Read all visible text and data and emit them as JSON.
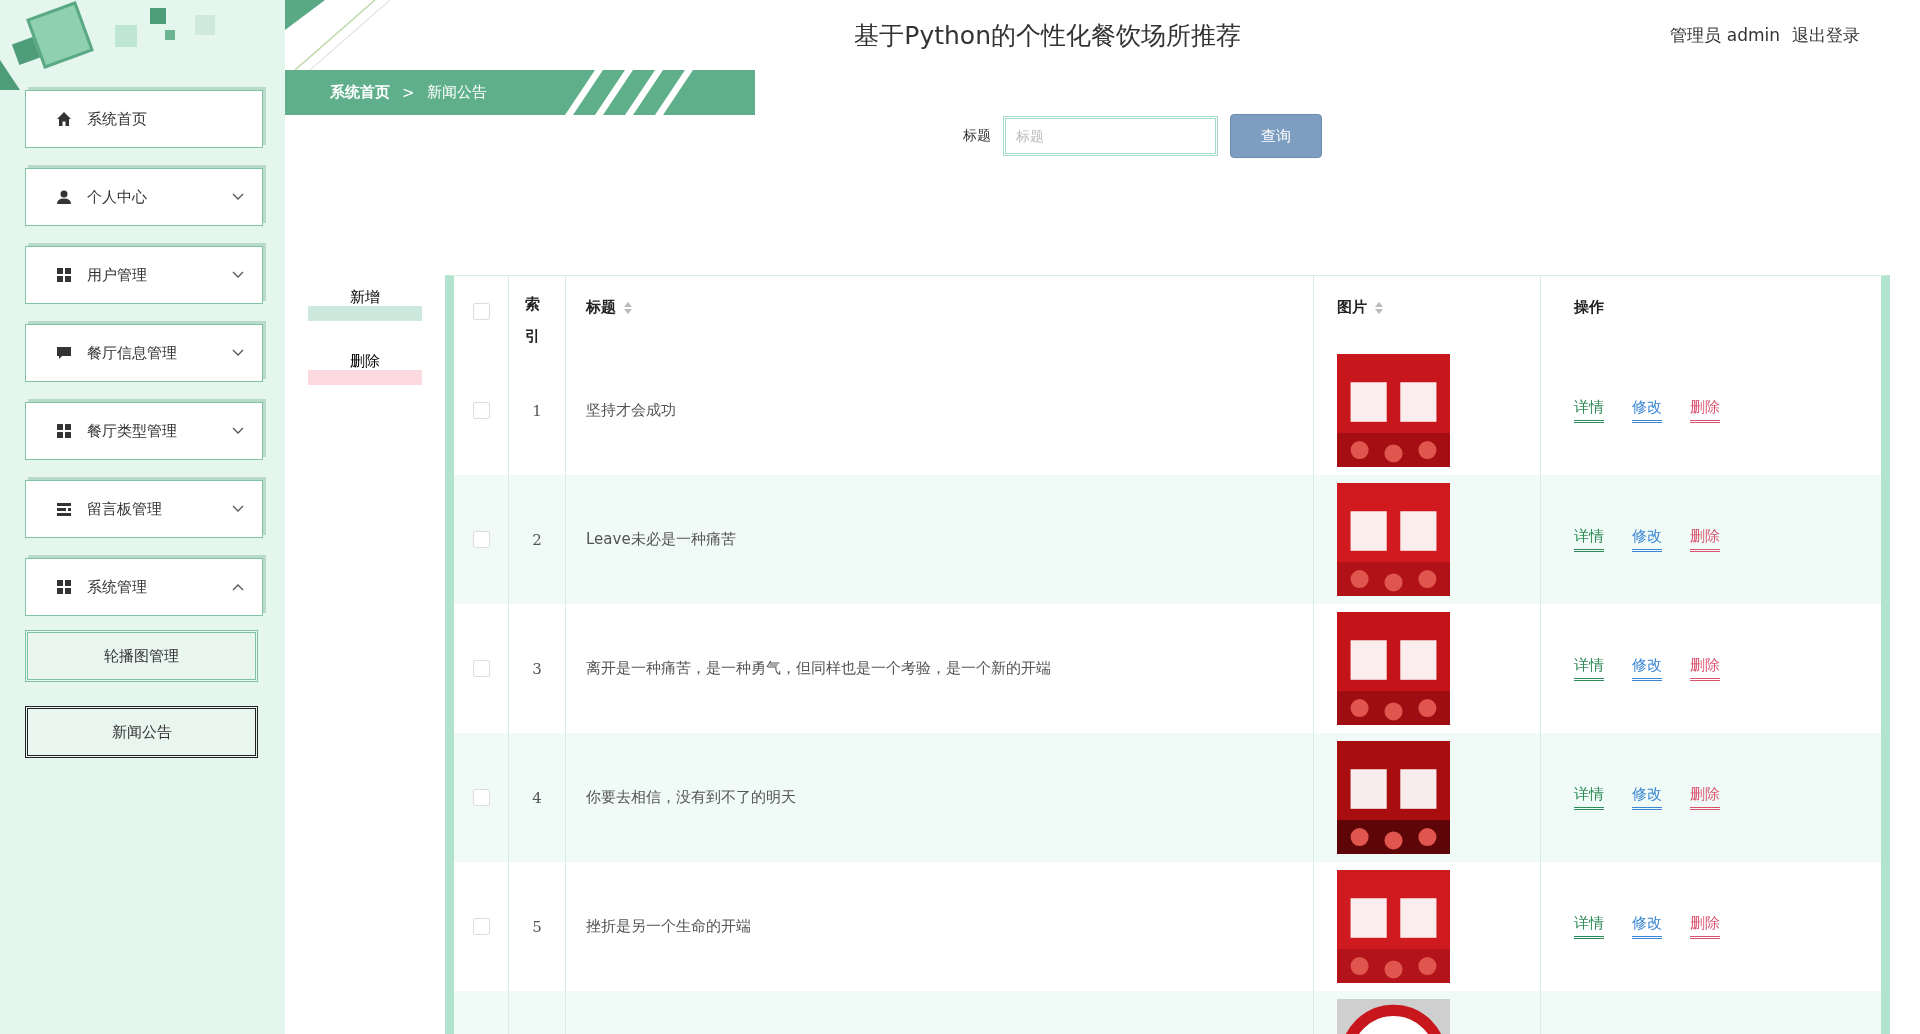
{
  "sidebar": {
    "items": [
      {
        "label": "系统首页",
        "kind": "home"
      },
      {
        "label": "个人中心",
        "kind": "person",
        "expanded": false
      },
      {
        "label": "用户管理",
        "kind": "grid",
        "expanded": false
      },
      {
        "label": "餐厅信息管理",
        "kind": "chat",
        "expanded": false
      },
      {
        "label": "餐厅类型管理",
        "kind": "grid",
        "expanded": false
      },
      {
        "label": "留言板管理",
        "kind": "list",
        "expanded": false
      },
      {
        "label": "系统管理",
        "kind": "grid",
        "expanded": true,
        "children": [
          {
            "label": "轮播图管理",
            "selected": false
          },
          {
            "label": "新闻公告",
            "selected": true
          }
        ]
      }
    ]
  },
  "header": {
    "title": "基于Python的个性化餐饮场所推荐",
    "user": "管理员 admin",
    "logout": "退出登录"
  },
  "breadcrumb": {
    "items": [
      "系统首页",
      "新闻公告"
    ],
    "separator": ">"
  },
  "search": {
    "label": "标题",
    "placeholder": "标题",
    "button": "查询"
  },
  "toolbar": [
    {
      "label": "新增",
      "kind": "add"
    },
    {
      "label": "删除",
      "kind": "delete"
    }
  ],
  "table": {
    "header_checked": false,
    "columns": [
      {
        "label": "索引"
      },
      {
        "label": "标题",
        "sortable": true
      },
      {
        "label": "图片",
        "sortable": true
      },
      {
        "label": "操作"
      }
    ],
    "rows": [
      {
        "kind": "full",
        "index": "1",
        "title": "坚持才会成功",
        "checked": false,
        "actions": [
          {
            "label": "详情",
            "color": "#2e8b57"
          },
          {
            "label": "修改",
            "color": "#3a86d4"
          },
          {
            "label": "删除",
            "color": "#d9536f"
          }
        ]
      },
      {
        "kind": "full",
        "index": "2",
        "title": "Leave未必是一种痛苦",
        "checked": false,
        "actions": [
          {
            "label": "详情",
            "color": "#2e8b57"
          },
          {
            "label": "修改",
            "color": "#3a86d4"
          },
          {
            "label": "删除",
            "color": "#d9536f"
          }
        ]
      },
      {
        "kind": "full",
        "index": "3",
        "title": "离开是一种痛苦，是一种勇气，但同样也是一个考验，是一个新的开端",
        "checked": false,
        "actions": [
          {
            "label": "详情",
            "color": "#2e8b57"
          },
          {
            "label": "修改",
            "color": "#3a86d4"
          },
          {
            "label": "删除",
            "color": "#d9536f"
          }
        ]
      },
      {
        "kind": "full",
        "index": "4",
        "title": "你要去相信，没有到不了的明天",
        "checked": false,
        "actions": [
          {
            "label": "详情",
            "color": "#2e8b57"
          },
          {
            "label": "修改",
            "color": "#3a86d4"
          },
          {
            "label": "删除",
            "color": "#d9536f"
          }
        ]
      },
      {
        "kind": "full",
        "index": "5",
        "title": "挫折是另一个生命的开端",
        "checked": false,
        "actions": [
          {
            "label": "详情",
            "color": "#2e8b57"
          },
          {
            "label": "修改",
            "color": "#3a86d4"
          },
          {
            "label": "删除",
            "color": "#d9536f"
          }
        ]
      },
      {
        "kind": "clipped"
      }
    ]
  }
}
